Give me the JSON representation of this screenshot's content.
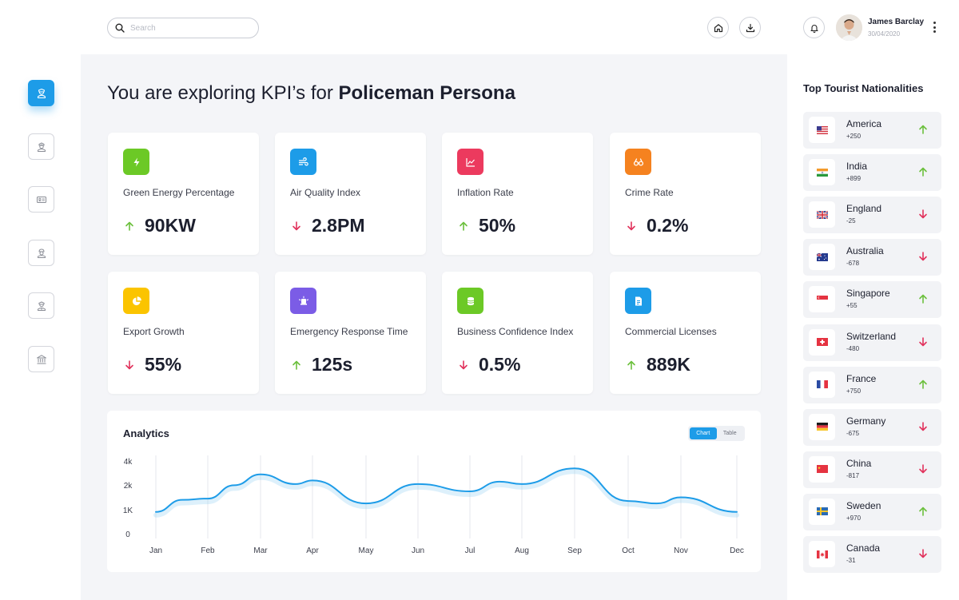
{
  "search": {
    "placeholder": "Search"
  },
  "user": {
    "name": "James Barclay",
    "date": "30/04/2020"
  },
  "heading": {
    "prefix": "You are exploring KPI’s for ",
    "persona": "Policeman Persona"
  },
  "colors": {
    "accent": "#1d9ce8",
    "up": "#6cc03d",
    "down": "#e1325c"
  },
  "kpis": [
    {
      "label": "Green Energy Percentage",
      "value": "90KW",
      "trend": "up",
      "icon": "lightning-icon",
      "color": "#6cc926"
    },
    {
      "label": "Air Quality Index",
      "value": "2.8PM",
      "trend": "down",
      "icon": "wind-icon",
      "color": "#1d9ce8"
    },
    {
      "label": "Inflation Rate",
      "value": "50%",
      "trend": "up",
      "icon": "line-chart-icon",
      "color": "#ec3a5e"
    },
    {
      "label": "Crime Rate",
      "value": "0.2%",
      "trend": "down",
      "icon": "binoculars-icon",
      "color": "#f5821f"
    },
    {
      "label": "Export Growth",
      "value": "55%",
      "trend": "down",
      "icon": "pie-chart-icon",
      "color": "#fbc400"
    },
    {
      "label": "Emergency Response Time",
      "value": "125s",
      "trend": "up",
      "icon": "siren-icon",
      "color": "#7b5ce6"
    },
    {
      "label": "Business Confidence Index",
      "value": "0.5%",
      "trend": "down",
      "icon": "coins-icon",
      "color": "#6cc926"
    },
    {
      "label": "Commercial Licenses",
      "value": "889K",
      "trend": "up",
      "icon": "document-icon",
      "color": "#1d9ce8"
    }
  ],
  "analytics": {
    "title": "Analytics",
    "toggle_chart": "Chart",
    "toggle_table": "Table"
  },
  "chart_data": {
    "type": "line",
    "title": "Analytics",
    "categories": [
      "Jan",
      "Feb",
      "Mar",
      "Apr",
      "May",
      "Jun",
      "Jul",
      "Aug",
      "Sep",
      "Oct",
      "Nov",
      "Dec"
    ],
    "y_tick_labels": [
      "0",
      "1K",
      "2k",
      "4k"
    ],
    "x": [
      "Jan",
      "Jan-Feb",
      "Feb",
      "Feb-Mar",
      "Mar",
      "Mar-Apr",
      "Apr",
      "May",
      "Jun",
      "Jul",
      "Jul-Aug",
      "Aug",
      "Sep",
      "Oct",
      "Oct-Nov",
      "Nov",
      "Dec"
    ],
    "values": [
      0.9,
      1.4,
      1.45,
      2.0,
      2.45,
      2.05,
      2.2,
      1.25,
      2.05,
      1.75,
      2.15,
      2.05,
      2.7,
      1.35,
      1.25,
      1.5,
      0.9
    ],
    "grid": "vertical",
    "legend": "none"
  },
  "right_panel": {
    "title": "Top Tourist Nationalities"
  },
  "nationalities": [
    {
      "name": "America",
      "count": "+250",
      "trend": "up",
      "flag": "usa-flag-icon"
    },
    {
      "name": "India",
      "count": "+899",
      "trend": "up",
      "flag": "india-flag-icon"
    },
    {
      "name": "England",
      "count": "-25",
      "trend": "down",
      "flag": "uk-flag-icon"
    },
    {
      "name": "Australia",
      "count": "-678",
      "trend": "down",
      "flag": "australia-flag-icon"
    },
    {
      "name": "Singapore",
      "count": "+55",
      "trend": "up",
      "flag": "singapore-flag-icon"
    },
    {
      "name": "Switzerland",
      "count": "-480",
      "trend": "down",
      "flag": "switzerland-flag-icon"
    },
    {
      "name": "France",
      "count": "+750",
      "trend": "up",
      "flag": "france-flag-icon"
    },
    {
      "name": "Germany",
      "count": "-675",
      "trend": "down",
      "flag": "germany-flag-icon"
    },
    {
      "name": "China",
      "count": "-817",
      "trend": "down",
      "flag": "china-flag-icon"
    },
    {
      "name": "Sweden",
      "count": "+970",
      "trend": "up",
      "flag": "sweden-flag-icon"
    },
    {
      "name": "Canada",
      "count": "-31",
      "trend": "down",
      "flag": "canada-flag-icon"
    }
  ]
}
